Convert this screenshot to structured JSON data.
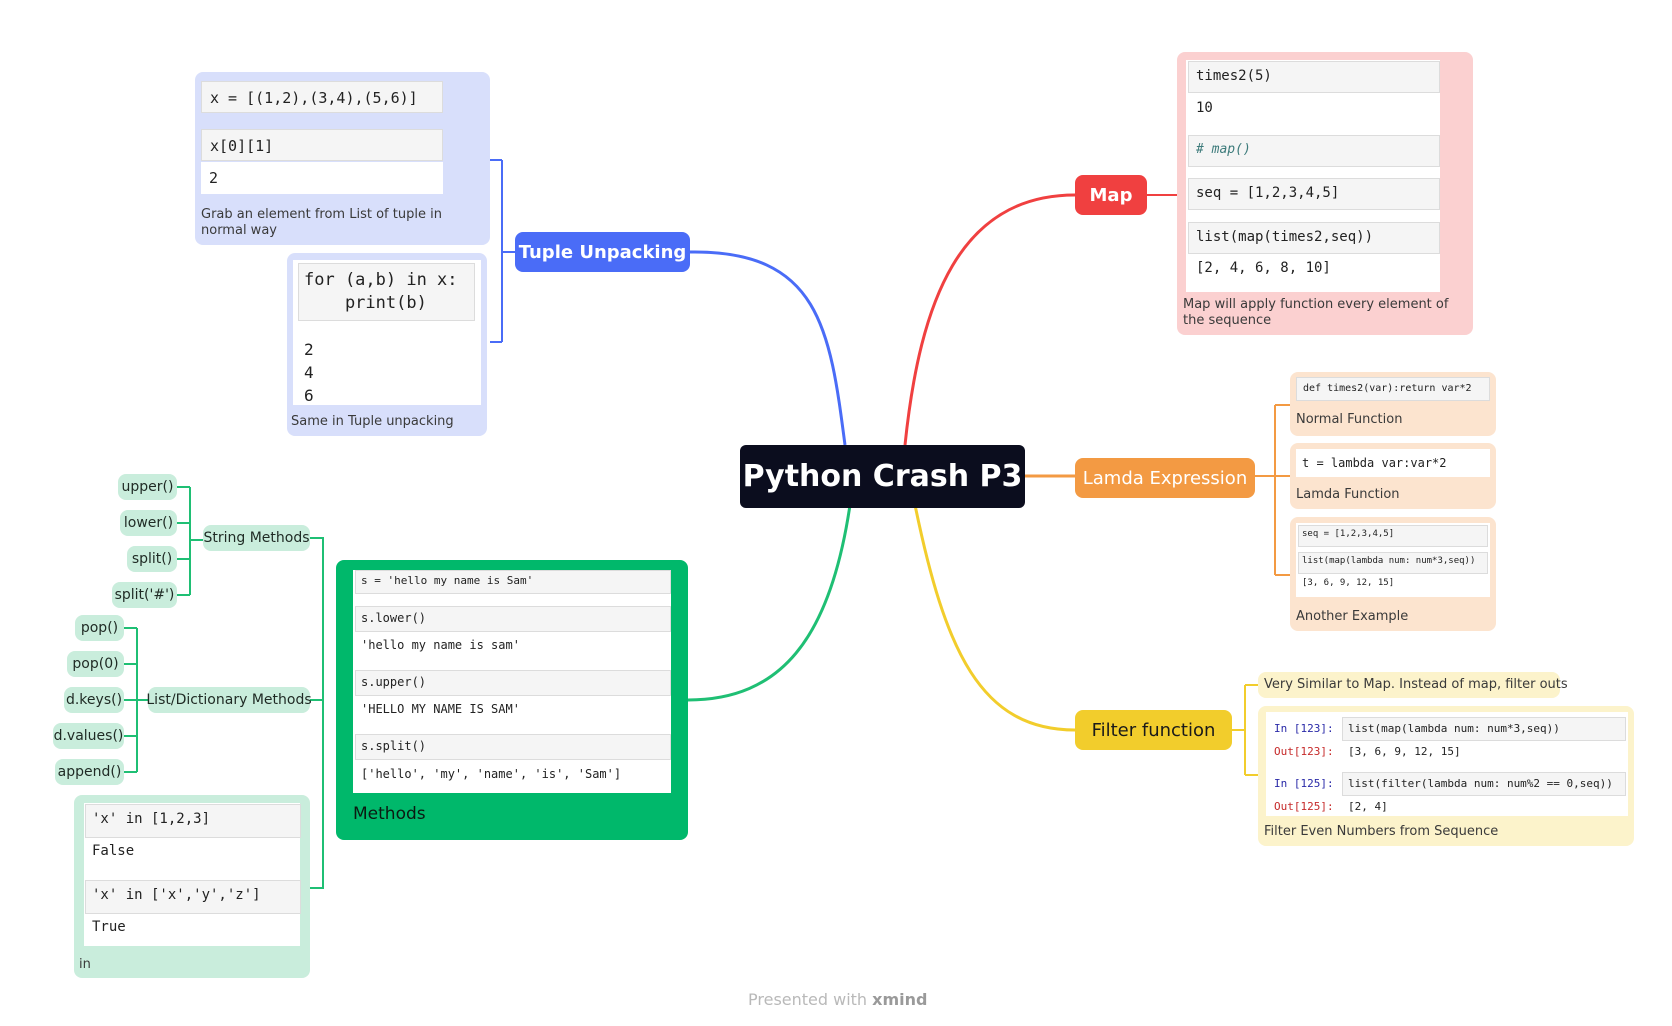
{
  "central": "Python Crash P3",
  "branches": {
    "tuple": {
      "label": "Tuple Unpacking",
      "color": "#4a6cf7",
      "card1": {
        "in1": "x = [(1,2),(3,4),(5,6)]",
        "in2": "x[0][1]",
        "out2": "2",
        "caption": "Grab an element from List of tuple in normal way"
      },
      "card2": {
        "line1": "for (a,b) in x:",
        "line2": "    print(b)",
        "outputs": [
          "2",
          "4",
          "6"
        ],
        "caption": "Same in Tuple unpacking"
      }
    },
    "map": {
      "label": "Map",
      "color": "#f04040",
      "cells": {
        "in1": "times2(5)",
        "out1": "10",
        "comment": "# map()",
        "in2": "seq = [1,2,3,4,5]",
        "in3": "list(map(times2,seq))",
        "out3": "[2, 4, 6, 8, 10]"
      },
      "caption": "Map will apply function every element of the sequence"
    },
    "lambda": {
      "label": "Lamda Expression",
      "color": "#f39a43",
      "sub1": {
        "code": "def times2(var):return var*2",
        "caption": "Normal Function"
      },
      "sub2": {
        "code": "t = lambda var:var*2",
        "caption": "Lamda Function"
      },
      "sub3": {
        "in1": "seq = [1,2,3,4,5]",
        "in2": "list(map(lambda num: num*3,seq))",
        "out2": "[3, 6, 9, 12, 15]",
        "caption": "Another Example"
      }
    },
    "filter": {
      "label": "Filter function",
      "color": "#f2cd2c",
      "note": "Very Similar to Map. Instead of map, filter outs",
      "cells": {
        "p1": "In [123]:",
        "in1": "list(map(lambda num: num*3,seq))",
        "po1": "Out[123]:",
        "out1": "[3, 6, 9, 12, 15]",
        "p2": "In [125]:",
        "in2": "list(filter(lambda num: num%2 == 0,seq))",
        "po2": "Out[125]:",
        "out2": "[2, 4]"
      },
      "caption": "Filter Even Numbers from Sequence"
    },
    "methods": {
      "label": "Methods",
      "color": "#00b86b",
      "cells": {
        "in0": "s = 'hello my name is Sam'",
        "in1": "s.lower()",
        "out1": "'hello my name is sam'",
        "in2": "s.upper()",
        "out2": "'HELLO MY NAME IS SAM'",
        "in3": "s.split()",
        "out3": "['hello', 'my', 'name', 'is', 'Sam']"
      },
      "string_methods": {
        "label": "String Methods",
        "items": [
          "upper()",
          "lower()",
          "split()",
          "split('#')"
        ]
      },
      "list_methods": {
        "label": "List/Dictionary Methods",
        "items": [
          "pop()",
          "pop(0)",
          "d.keys()",
          "d.values()",
          "append()"
        ]
      },
      "in_card": {
        "in1": "'x' in [1,2,3]",
        "out1": "False",
        "in2": "'x' in ['x','y','z']",
        "out2": "True",
        "caption": "in"
      }
    }
  },
  "footer": {
    "text": "Presented with",
    "brand": "xmind"
  }
}
